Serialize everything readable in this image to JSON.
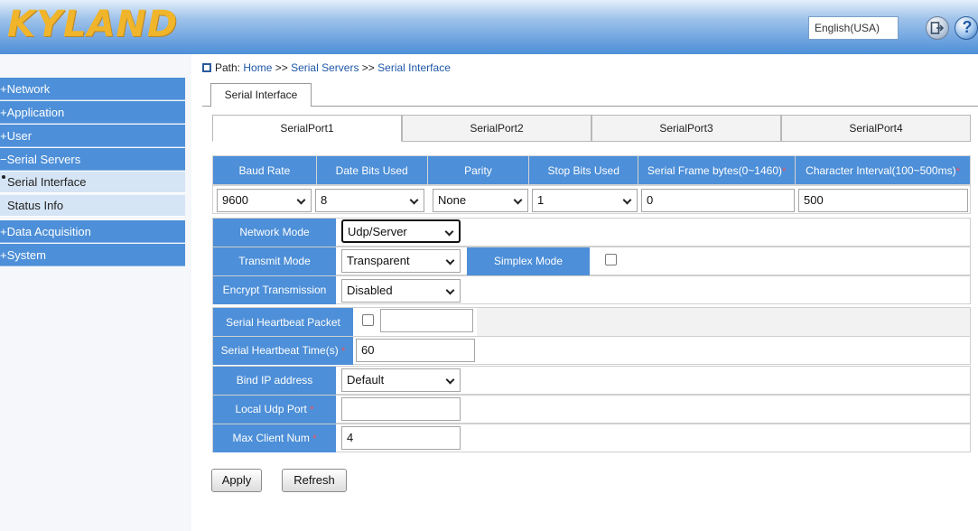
{
  "header": {
    "logo_text": "KYLAND",
    "language": "English(USA)"
  },
  "sidebar": {
    "items": [
      {
        "label": "+Network"
      },
      {
        "label": "+Application"
      },
      {
        "label": "+User"
      },
      {
        "label": "−Serial Servers"
      },
      {
        "label": "Serial Interface"
      },
      {
        "label": "Status Info"
      },
      {
        "label": "+Data Acquisition"
      },
      {
        "label": "+System"
      }
    ]
  },
  "breadcrumb": {
    "label": "Path:",
    "home": "Home",
    "sep": ">>",
    "section": "Serial Servers",
    "page": "Serial Interface"
  },
  "main": {
    "outer_tab": "Serial Interface",
    "port_tabs": [
      "SerialPort1",
      "SerialPort2",
      "SerialPort3",
      "SerialPort4"
    ],
    "columns": [
      "Baud Rate",
      "Date Bits Used",
      "Parity",
      "Stop Bits Used",
      "Serial Frame bytes(0~1460)",
      "Character Interval(100~500ms)"
    ],
    "values": {
      "baud_rate": "9600",
      "data_bits": "8",
      "parity": "None",
      "stop_bits": "1",
      "frame_bytes": "0",
      "char_interval": "500"
    },
    "form": {
      "network_mode_label": "Network Mode",
      "network_mode": "Udp/Server",
      "transmit_mode_label": "Transmit Mode",
      "transmit_mode": "Transparent",
      "simplex_mode_label": "Simplex Mode",
      "encrypt_label": "Encrypt Transmission",
      "encrypt": "Disabled",
      "heartbeat_packet_label": "Serial Heartbeat Packet",
      "heartbeat_packet": "",
      "heartbeat_time_label": "Serial Heartbeat Time(s)",
      "heartbeat_time": "60",
      "bind_ip_label": "Bind IP address",
      "bind_ip": "Default",
      "local_port_label": "Local Udp Port",
      "local_port": "",
      "max_client_label": "Max Client Num",
      "max_client": "4"
    },
    "buttons": {
      "apply": "Apply",
      "refresh": "Refresh"
    },
    "required_mark": "*"
  },
  "colors": {
    "accent": "#4d8fd8",
    "required": "#ff4d4d"
  }
}
